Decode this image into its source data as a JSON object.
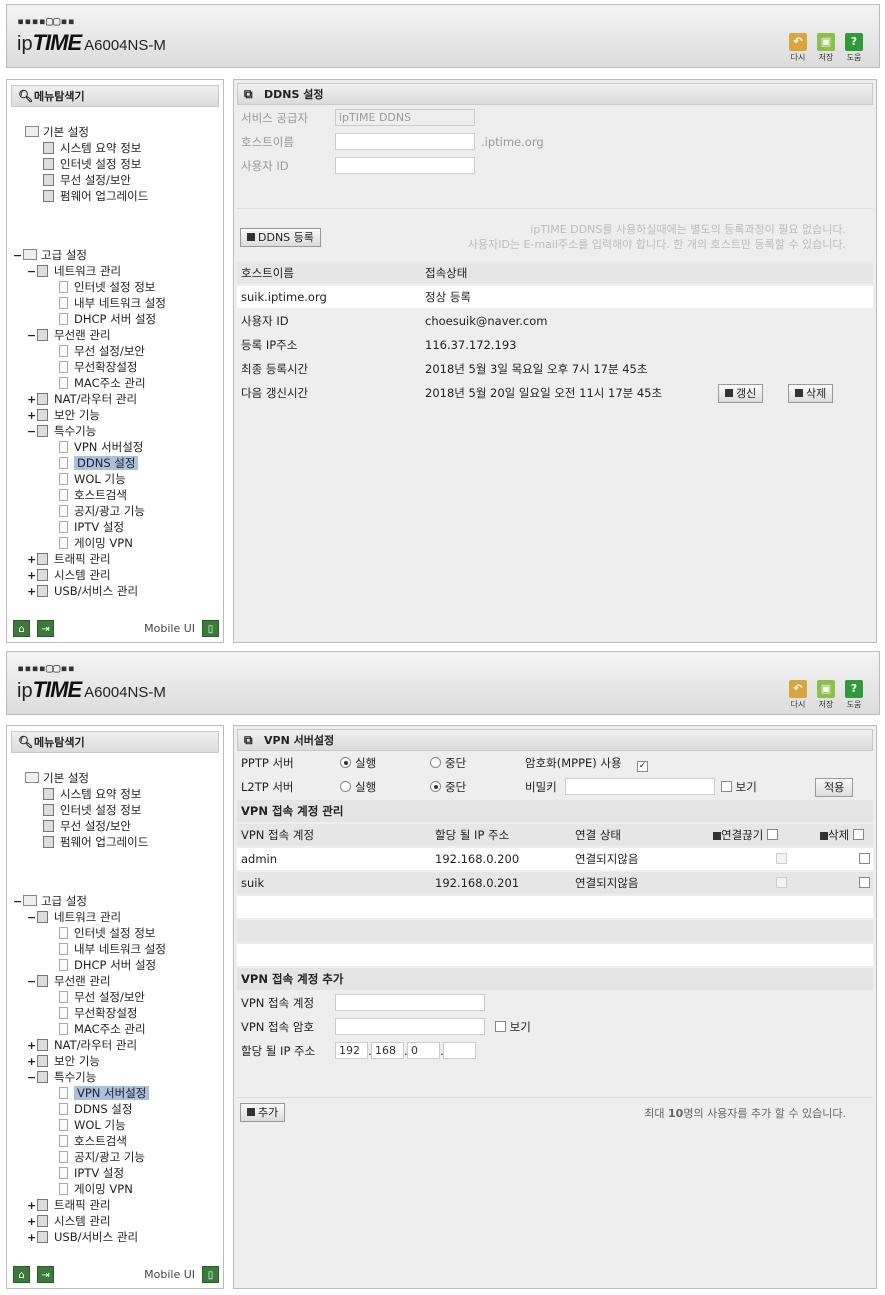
{
  "header": {
    "logo_dots": "▪▪▪▪▢▢▪▪",
    "logo_ip": "ip",
    "logo_time": "TIME",
    "model": "A6004NS-M",
    "buttons": [
      {
        "icon": "undo-icon",
        "label": "다시",
        "color": "#d9a53f"
      },
      {
        "icon": "save-icon",
        "label": "저장",
        "color": "#8cc04a"
      },
      {
        "icon": "help-icon",
        "label": "도움",
        "color": "#2f9a3a"
      }
    ]
  },
  "sidebar": {
    "title": "메뉴탐색기",
    "mobile_label": "Mobile UI",
    "basic": {
      "label": "기본 설정",
      "items": [
        "시스템 요약 정보",
        "인터넷 설정 정보",
        "무선 설정/보안",
        "펌웨어 업그레이드"
      ]
    },
    "advanced": {
      "label": "고급 설정",
      "network": {
        "label": "네트워크 관리",
        "items": [
          "인터넷 설정 정보",
          "내부 네트워크 설정",
          "DHCP 서버 설정"
        ]
      },
      "wireless": {
        "label": "무선랜 관리",
        "items": [
          "무선 설정/보안",
          "무선확장설정",
          "MAC주소 관리"
        ]
      },
      "nat": "NAT/라우터 관리",
      "security": "보안 기능",
      "special": {
        "label": "특수기능",
        "items": [
          "VPN 서버설정",
          "DDNS 설정",
          "WOL 기능",
          "호스트검색",
          "공지/광고 기능",
          "IPTV 설정",
          "게이밍 VPN"
        ]
      },
      "traffic": "트래픽 관리",
      "system": "시스템 관리",
      "usb": "USB/서비스 관리"
    }
  },
  "ddns": {
    "title": "DDNS 설정",
    "provider_label": "서비스 공급자",
    "provider_value": "ipTIME DDNS",
    "host_label": "호스트이름",
    "host_suffix": ".iptime.org",
    "user_label": "사용자 ID",
    "register_button": "DDNS 등록",
    "notice_line1": "ipTIME DDNS를 사용하실때에는 별도의 등록과정이 필요 없습니다.",
    "notice_line2": "사용자ID는 E-mail주소를 입력해야 합니다. 한 개의 호스트만 등록할 수 있습니다.",
    "table_headers": [
      "호스트이름",
      "접속상태"
    ],
    "host_row": [
      "suik.iptime.org",
      "정상 등록"
    ],
    "details": [
      [
        "사용자 ID",
        "choesuik@naver.com"
      ],
      [
        "등록 IP주소",
        "116.37.172.193"
      ],
      [
        "최종 등록시간",
        "2018년 5월 3일 목요일 오후 7시 17분 45초"
      ],
      [
        "다음 갱신시간",
        "2018년 5월 20일 일요일 오전 11시 17분 45초"
      ]
    ],
    "renew_button": "갱신",
    "delete_button": "삭제"
  },
  "vpn": {
    "title": "VPN 서버설정",
    "pptp_label": "PPTP 서버",
    "l2tp_label": "L2TP 서버",
    "run_label": "실행",
    "stop_label": "중단",
    "mppe_label": "암호화(MPPE) 사용",
    "secret_label": "비밀키",
    "show_label": "보기",
    "apply_button": "적용",
    "accounts_title": "VPN 접속 계정 관리",
    "table_headers": [
      "VPN 접속 계정",
      "할당 될 IP 주소",
      "연결 상태",
      "연결끊기",
      "삭제"
    ],
    "accounts": [
      [
        "admin",
        "192.168.0.200",
        "연결되지않음"
      ],
      [
        "suik",
        "192.168.0.201",
        "연결되지않음"
      ]
    ],
    "add_title": "VPN 접속 계정 추가",
    "add_account_label": "VPN 접속 계정",
    "add_password_label": "VPN 접속 암호",
    "add_ip_label": "할당 될 IP 주소",
    "ip_parts": [
      "192",
      "168",
      "0",
      ""
    ],
    "add_button": "추가",
    "max_notice_pre": "최대 ",
    "max_notice_num": "10",
    "max_notice_post": "명의 사용자를 추가 할 수 있습니다."
  }
}
